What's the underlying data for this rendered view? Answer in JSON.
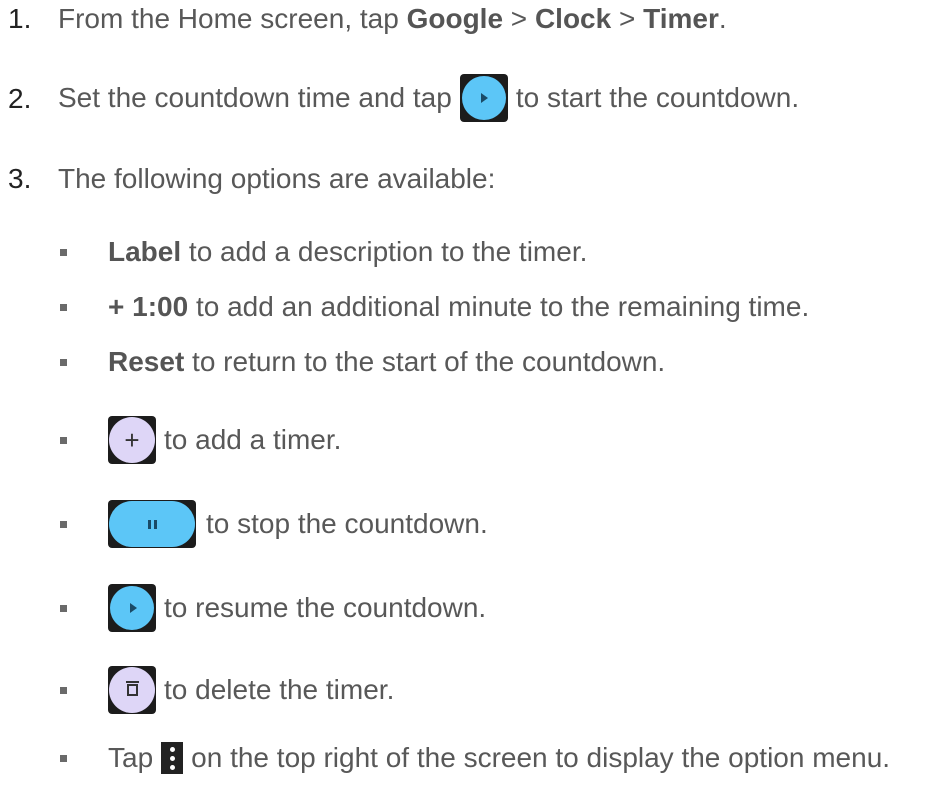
{
  "steps": [
    {
      "number": "1.",
      "prefix": "From the Home screen, tap ",
      "path": [
        "Google",
        "Clock",
        "Timer"
      ],
      "separator": " > ",
      "suffix": "."
    },
    {
      "number": "2.",
      "before": "Set the countdown time and tap",
      "after": "to start the countdown."
    },
    {
      "number": "3.",
      "text": "The following options are available:"
    }
  ],
  "options": {
    "label": {
      "bold": "Label",
      "text": " to add a description to the timer."
    },
    "add_minute": {
      "bold": "+ 1:00",
      "text": " to add an additional minute to the remaining time."
    },
    "reset": {
      "bold": "Reset",
      "text": " to return to the start of the countdown."
    },
    "add_timer": {
      "icon_glyph": "+",
      "text": "to add a timer."
    },
    "stop": {
      "text": "to stop the countdown."
    },
    "resume": {
      "text": "to resume the countdown."
    },
    "delete": {
      "text": "to delete the timer."
    },
    "menu": {
      "before": "Tap",
      "after": "on the top right of the screen to display the option menu."
    }
  },
  "icons": {
    "play": "play-icon",
    "add": "plus-icon",
    "pause": "pause-icon",
    "delete": "trash-icon",
    "overflow": "more-vert-icon"
  },
  "colors": {
    "text": "#585858",
    "play_blue": "#5cc6f7",
    "add_purple": "#ded6f7",
    "icon_frame": "#1c1c1c"
  }
}
